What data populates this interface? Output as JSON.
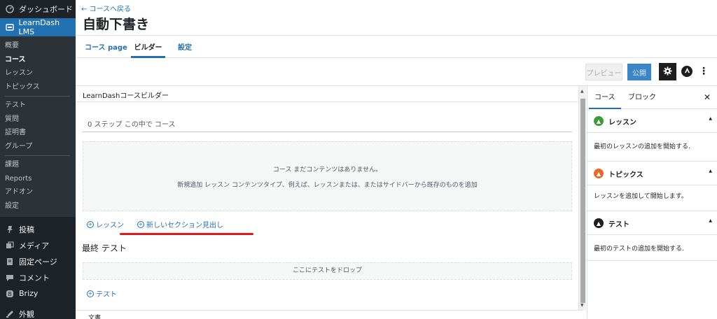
{
  "admin_menu": {
    "top": [
      {
        "label": "ダッシュボード",
        "icon": "dashboard-icon"
      },
      {
        "label": "LearnDash LMS",
        "icon": "learndash-icon"
      }
    ],
    "sub": [
      {
        "label": "概要"
      },
      {
        "label": "コース"
      },
      {
        "label": "レッスン"
      },
      {
        "label": "トピックス"
      },
      {
        "label": "テスト"
      },
      {
        "label": "質問"
      },
      {
        "label": "証明書"
      },
      {
        "label": "グループ"
      },
      {
        "label": "課題"
      },
      {
        "label": "Reports"
      },
      {
        "label": "アドオン"
      },
      {
        "label": "設定"
      }
    ],
    "bottom": [
      {
        "label": "投稿",
        "icon": "pin-icon"
      },
      {
        "label": "メディア",
        "icon": "media-icon"
      },
      {
        "label": "固定ページ",
        "icon": "pages-icon"
      },
      {
        "label": "コメント",
        "icon": "comment-icon"
      },
      {
        "label": "Brizy",
        "icon": "brizy-icon"
      },
      {
        "label": "外観",
        "icon": "appearance-icon"
      }
    ]
  },
  "header": {
    "back_link": "← コースへ戻る",
    "title": "自動下書き"
  },
  "tabs": [
    {
      "label": "コース page"
    },
    {
      "label": "ビルダー"
    },
    {
      "label": "設定"
    }
  ],
  "toolbar": {
    "preview_label": "プレビュー",
    "publish_label": "公開",
    "settings_icon": "gear-icon",
    "astra_icon": "astra-logo-icon",
    "more_icon": "more-vertical-icon"
  },
  "builder": {
    "title": "LearnDashコースビルダー",
    "steps_text": "0 ステップ この中で コース",
    "empty_line1": "コース まだコンテンツはありません。",
    "empty_line2": "新規追加 レッスン コンテンツタイプ、例えば、レッスンまたは、またはサイドバーから既存のものを追加",
    "add_lesson": "レッスン",
    "add_section": "新しいセクション見出し",
    "final_quiz_title": "最終 テスト",
    "drop_zone": "ここにテストをドロップ",
    "add_quiz": "テスト"
  },
  "footer": {
    "doc_label": "文書"
  },
  "panel": {
    "tab_course": "コース",
    "tab_block": "ブロック",
    "close": "✕",
    "sections": [
      {
        "title": "レッスン",
        "body": "最初のレッスンの追加を開始する.",
        "color": "#3e9a3a"
      },
      {
        "title": "トピックス",
        "body": "レッスンを追加して開始します。",
        "color": "#e8692a"
      },
      {
        "title": "テスト",
        "body": "最初のテストの追加を開始する.",
        "color": "#1e1e1e"
      }
    ]
  },
  "colors": {
    "admin_bg": "#1d2327",
    "accent": "#2271b1",
    "highlight": "#e0171b"
  }
}
